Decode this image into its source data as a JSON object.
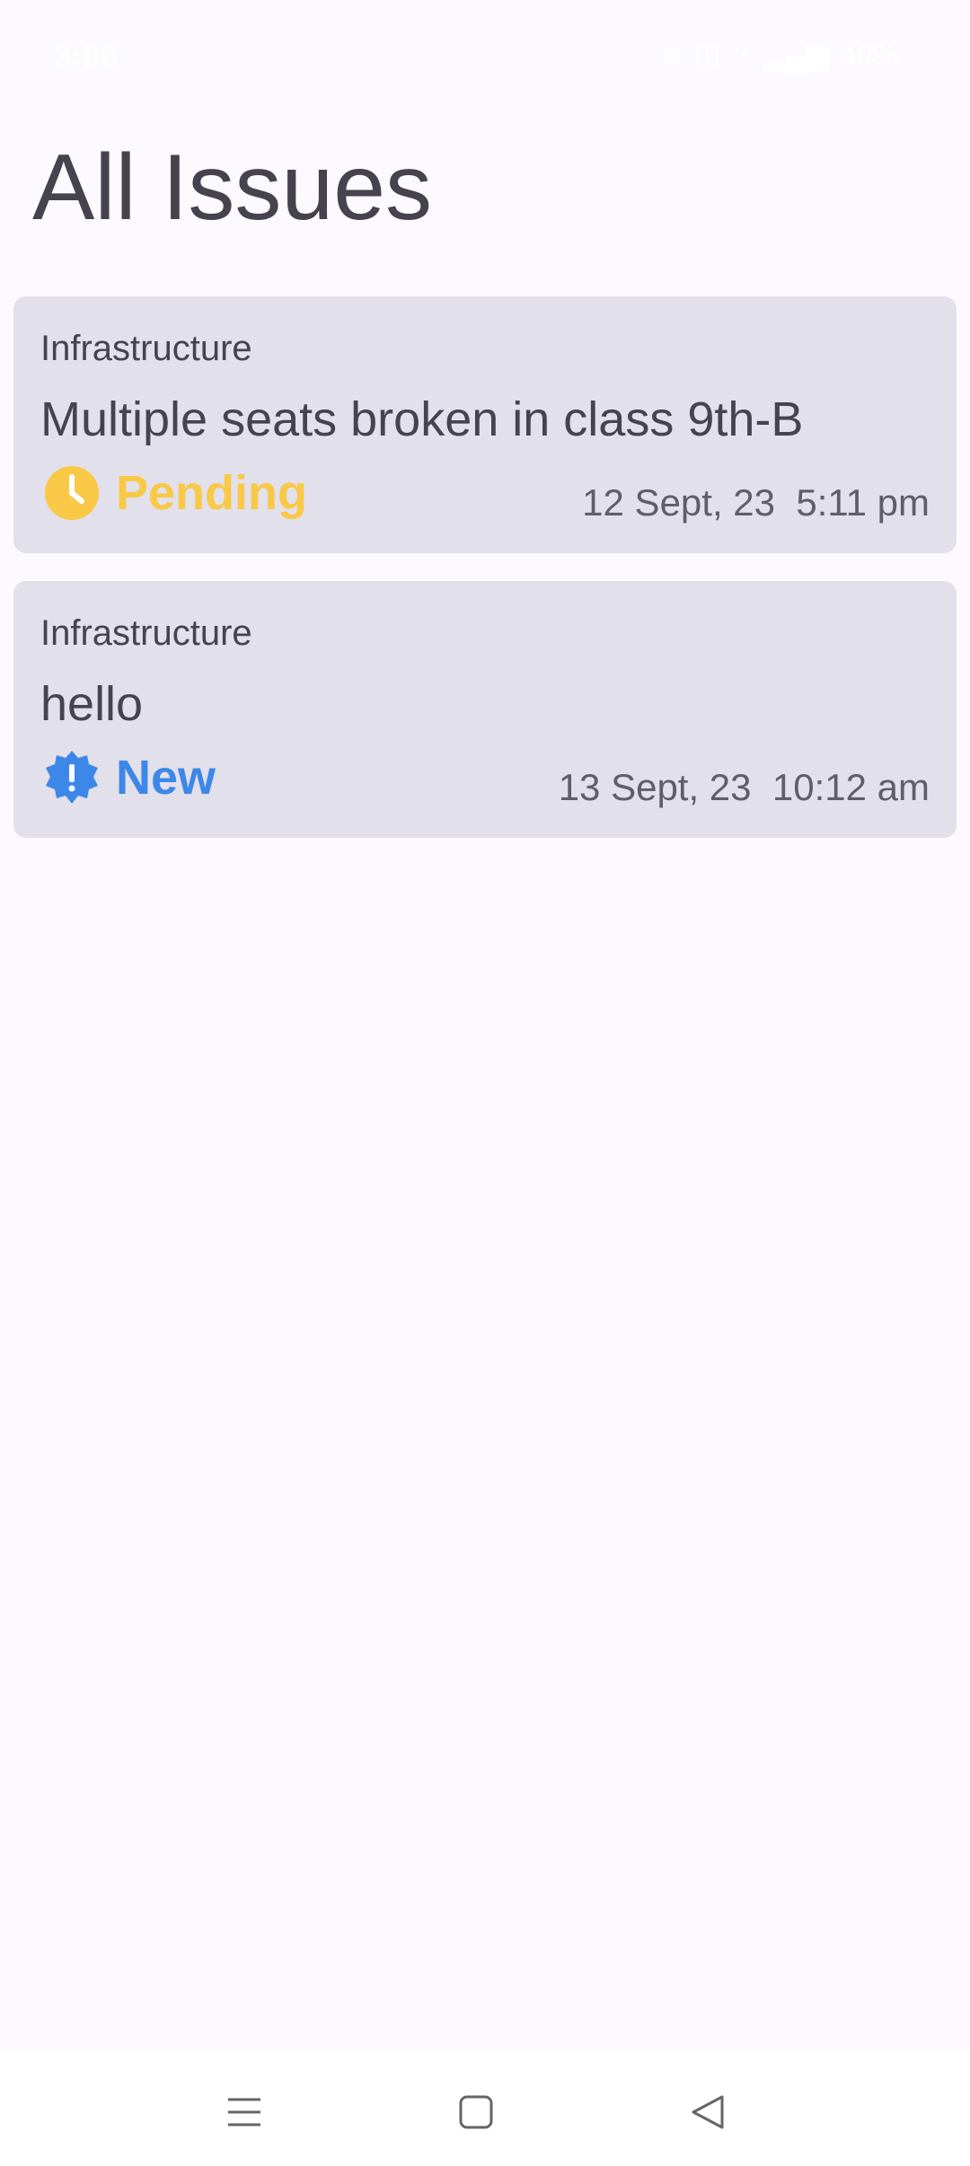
{
  "status_bar": {
    "time": "3:06",
    "battery": "49%"
  },
  "page": {
    "title": "All Issues"
  },
  "issues": [
    {
      "category": "Infrastructure",
      "title": "Multiple seats broken in class 9th-B",
      "status": "Pending",
      "status_icon": "clock-icon",
      "status_color": "#f9c846",
      "date": "12 Sept, 23",
      "time": "5:11 pm"
    },
    {
      "category": "Infrastructure",
      "title": "hello",
      "status": "New",
      "status_icon": "new-badge-icon",
      "status_color": "#3d87e8",
      "date": "13 Sept, 23",
      "time": "10:12 am"
    }
  ],
  "colors": {
    "background": "#fcfaff",
    "card": "#e2e0ea",
    "text": "#44434e",
    "pending": "#f9c846",
    "new": "#3d87e8"
  },
  "nav": {
    "icons": [
      "menu-icon",
      "home-square-icon",
      "back-triangle-icon"
    ]
  }
}
